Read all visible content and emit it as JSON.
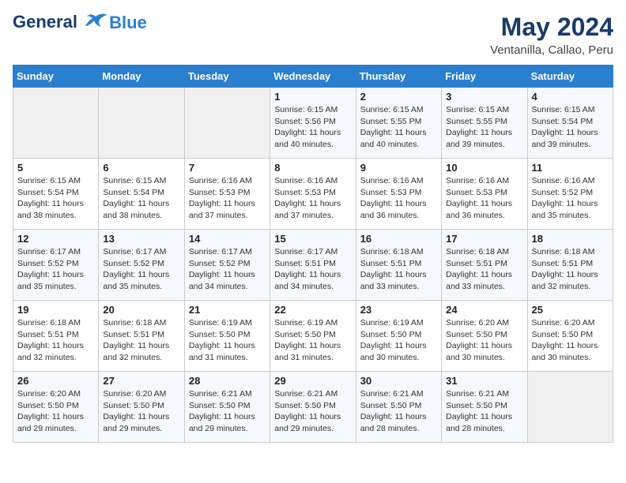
{
  "header": {
    "logo_line1": "General",
    "logo_line2": "Blue",
    "month_year": "May 2024",
    "location": "Ventanilla, Callao, Peru"
  },
  "weekdays": [
    "Sunday",
    "Monday",
    "Tuesday",
    "Wednesday",
    "Thursday",
    "Friday",
    "Saturday"
  ],
  "weeks": [
    [
      {
        "day": "",
        "sunrise": "",
        "sunset": "",
        "daylight": ""
      },
      {
        "day": "",
        "sunrise": "",
        "sunset": "",
        "daylight": ""
      },
      {
        "day": "",
        "sunrise": "",
        "sunset": "",
        "daylight": ""
      },
      {
        "day": "1",
        "sunrise": "Sunrise: 6:15 AM",
        "sunset": "Sunset: 5:56 PM",
        "daylight": "Daylight: 11 hours and 40 minutes."
      },
      {
        "day": "2",
        "sunrise": "Sunrise: 6:15 AM",
        "sunset": "Sunset: 5:55 PM",
        "daylight": "Daylight: 11 hours and 40 minutes."
      },
      {
        "day": "3",
        "sunrise": "Sunrise: 6:15 AM",
        "sunset": "Sunset: 5:55 PM",
        "daylight": "Daylight: 11 hours and 39 minutes."
      },
      {
        "day": "4",
        "sunrise": "Sunrise: 6:15 AM",
        "sunset": "Sunset: 5:54 PM",
        "daylight": "Daylight: 11 hours and 39 minutes."
      }
    ],
    [
      {
        "day": "5",
        "sunrise": "Sunrise: 6:15 AM",
        "sunset": "Sunset: 5:54 PM",
        "daylight": "Daylight: 11 hours and 38 minutes."
      },
      {
        "day": "6",
        "sunrise": "Sunrise: 6:15 AM",
        "sunset": "Sunset: 5:54 PM",
        "daylight": "Daylight: 11 hours and 38 minutes."
      },
      {
        "day": "7",
        "sunrise": "Sunrise: 6:16 AM",
        "sunset": "Sunset: 5:53 PM",
        "daylight": "Daylight: 11 hours and 37 minutes."
      },
      {
        "day": "8",
        "sunrise": "Sunrise: 6:16 AM",
        "sunset": "Sunset: 5:53 PM",
        "daylight": "Daylight: 11 hours and 37 minutes."
      },
      {
        "day": "9",
        "sunrise": "Sunrise: 6:16 AM",
        "sunset": "Sunset: 5:53 PM",
        "daylight": "Daylight: 11 hours and 36 minutes."
      },
      {
        "day": "10",
        "sunrise": "Sunrise: 6:16 AM",
        "sunset": "Sunset: 5:53 PM",
        "daylight": "Daylight: 11 hours and 36 minutes."
      },
      {
        "day": "11",
        "sunrise": "Sunrise: 6:16 AM",
        "sunset": "Sunset: 5:52 PM",
        "daylight": "Daylight: 11 hours and 35 minutes."
      }
    ],
    [
      {
        "day": "12",
        "sunrise": "Sunrise: 6:17 AM",
        "sunset": "Sunset: 5:52 PM",
        "daylight": "Daylight: 11 hours and 35 minutes."
      },
      {
        "day": "13",
        "sunrise": "Sunrise: 6:17 AM",
        "sunset": "Sunset: 5:52 PM",
        "daylight": "Daylight: 11 hours and 35 minutes."
      },
      {
        "day": "14",
        "sunrise": "Sunrise: 6:17 AM",
        "sunset": "Sunset: 5:52 PM",
        "daylight": "Daylight: 11 hours and 34 minutes."
      },
      {
        "day": "15",
        "sunrise": "Sunrise: 6:17 AM",
        "sunset": "Sunset: 5:51 PM",
        "daylight": "Daylight: 11 hours and 34 minutes."
      },
      {
        "day": "16",
        "sunrise": "Sunrise: 6:18 AM",
        "sunset": "Sunset: 5:51 PM",
        "daylight": "Daylight: 11 hours and 33 minutes."
      },
      {
        "day": "17",
        "sunrise": "Sunrise: 6:18 AM",
        "sunset": "Sunset: 5:51 PM",
        "daylight": "Daylight: 11 hours and 33 minutes."
      },
      {
        "day": "18",
        "sunrise": "Sunrise: 6:18 AM",
        "sunset": "Sunset: 5:51 PM",
        "daylight": "Daylight: 11 hours and 32 minutes."
      }
    ],
    [
      {
        "day": "19",
        "sunrise": "Sunrise: 6:18 AM",
        "sunset": "Sunset: 5:51 PM",
        "daylight": "Daylight: 11 hours and 32 minutes."
      },
      {
        "day": "20",
        "sunrise": "Sunrise: 6:18 AM",
        "sunset": "Sunset: 5:51 PM",
        "daylight": "Daylight: 11 hours and 32 minutes."
      },
      {
        "day": "21",
        "sunrise": "Sunrise: 6:19 AM",
        "sunset": "Sunset: 5:50 PM",
        "daylight": "Daylight: 11 hours and 31 minutes."
      },
      {
        "day": "22",
        "sunrise": "Sunrise: 6:19 AM",
        "sunset": "Sunset: 5:50 PM",
        "daylight": "Daylight: 11 hours and 31 minutes."
      },
      {
        "day": "23",
        "sunrise": "Sunrise: 6:19 AM",
        "sunset": "Sunset: 5:50 PM",
        "daylight": "Daylight: 11 hours and 30 minutes."
      },
      {
        "day": "24",
        "sunrise": "Sunrise: 6:20 AM",
        "sunset": "Sunset: 5:50 PM",
        "daylight": "Daylight: 11 hours and 30 minutes."
      },
      {
        "day": "25",
        "sunrise": "Sunrise: 6:20 AM",
        "sunset": "Sunset: 5:50 PM",
        "daylight": "Daylight: 11 hours and 30 minutes."
      }
    ],
    [
      {
        "day": "26",
        "sunrise": "Sunrise: 6:20 AM",
        "sunset": "Sunset: 5:50 PM",
        "daylight": "Daylight: 11 hours and 29 minutes."
      },
      {
        "day": "27",
        "sunrise": "Sunrise: 6:20 AM",
        "sunset": "Sunset: 5:50 PM",
        "daylight": "Daylight: 11 hours and 29 minutes."
      },
      {
        "day": "28",
        "sunrise": "Sunrise: 6:21 AM",
        "sunset": "Sunset: 5:50 PM",
        "daylight": "Daylight: 11 hours and 29 minutes."
      },
      {
        "day": "29",
        "sunrise": "Sunrise: 6:21 AM",
        "sunset": "Sunset: 5:50 PM",
        "daylight": "Daylight: 11 hours and 29 minutes."
      },
      {
        "day": "30",
        "sunrise": "Sunrise: 6:21 AM",
        "sunset": "Sunset: 5:50 PM",
        "daylight": "Daylight: 11 hours and 28 minutes."
      },
      {
        "day": "31",
        "sunrise": "Sunrise: 6:21 AM",
        "sunset": "Sunset: 5:50 PM",
        "daylight": "Daylight: 11 hours and 28 minutes."
      },
      {
        "day": "",
        "sunrise": "",
        "sunset": "",
        "daylight": ""
      }
    ]
  ]
}
